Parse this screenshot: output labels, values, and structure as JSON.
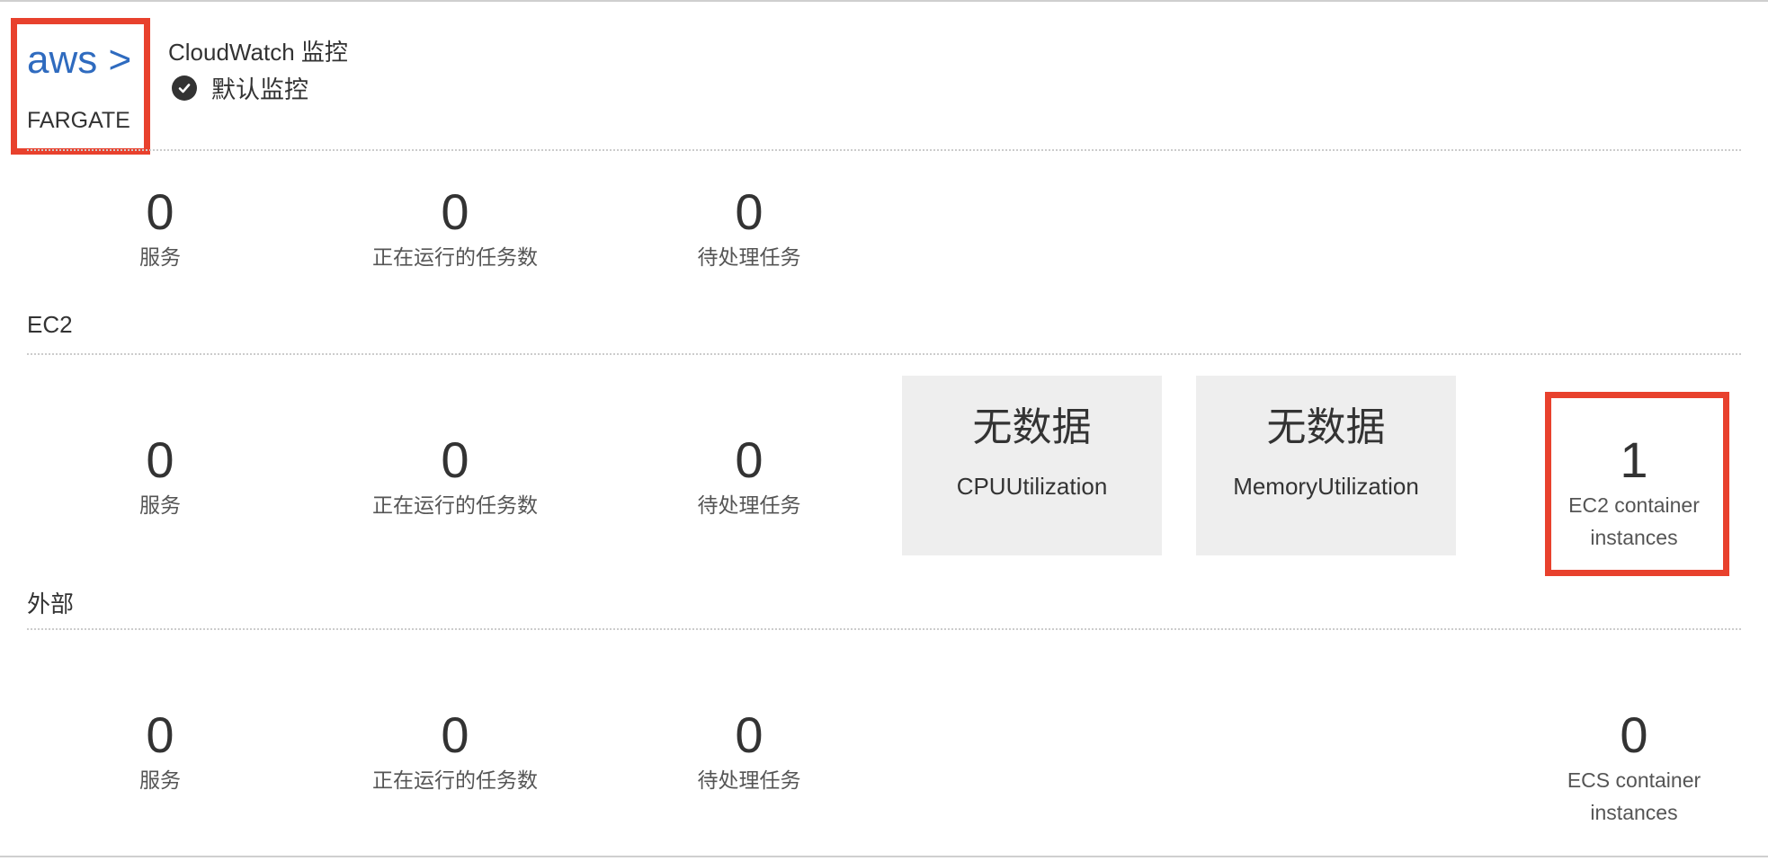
{
  "launch_type": {
    "logo": "aws >",
    "name": "FARGATE"
  },
  "cloudwatch": {
    "title": "CloudWatch 监控",
    "status": "默认监控"
  },
  "fargate_section": {
    "metrics": [
      {
        "value": "0",
        "label": "服务"
      },
      {
        "value": "0",
        "label": "正在运行的任务数"
      },
      {
        "value": "0",
        "label": "待处理任务"
      }
    ]
  },
  "ec2_section": {
    "title": "EC2",
    "metrics": [
      {
        "value": "0",
        "label": "服务"
      },
      {
        "value": "0",
        "label": "正在运行的任务数"
      },
      {
        "value": "0",
        "label": "待处理任务"
      }
    ],
    "cpu": {
      "no_data": "无数据",
      "metric": "CPUUtilization"
    },
    "memory": {
      "no_data": "无数据",
      "metric": "MemoryUtilization"
    },
    "instances": {
      "value": "1",
      "label_line1": "EC2 container",
      "label_line2": "instances"
    }
  },
  "external_section": {
    "title": "外部",
    "metrics": [
      {
        "value": "0",
        "label": "服务"
      },
      {
        "value": "0",
        "label": "正在运行的任务数"
      },
      {
        "value": "0",
        "label": "待处理任务"
      }
    ],
    "instances": {
      "value": "0",
      "label_line1": "ECS container",
      "label_line2": "instances"
    }
  },
  "colors": {
    "highlight": "#e8412d",
    "aws_blue": "#2f6bbf",
    "panel_gray": "#eeeeee"
  }
}
